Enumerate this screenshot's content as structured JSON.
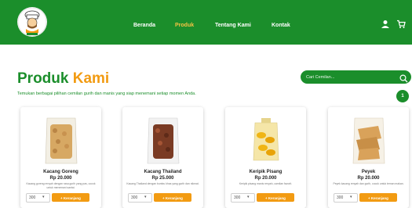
{
  "nav": {
    "links": [
      "Beranda",
      "Produk",
      "Tentang Kami",
      "Kontak"
    ],
    "active": "Produk",
    "icons": [
      "user-icon",
      "cart-icon"
    ]
  },
  "header": {
    "title_part1": "Produk",
    "title_part2": "Kami",
    "subtitle": "Temukan berbagai pilihan cemilan gurih dan manis yang siap menemani setiap momen Anda."
  },
  "search": {
    "placeholder": "Cari Cemilan..."
  },
  "cart": {
    "count": "1"
  },
  "products": [
    {
      "name": "Kacang Goreng",
      "price": "Rp 20.000",
      "desc": "Kacang goreng renyah dengan rasa gurih yang pas, cocok untuk menemani santai.",
      "qty": "300",
      "add_label": "+ Keranjang"
    },
    {
      "name": "Kacang Thailand",
      "price": "Rp 25.000",
      "desc": "Kacang Thailand dengan bumbu khas yang gurih dan nikmat.",
      "qty": "300",
      "add_label": "+ Keranjang"
    },
    {
      "name": "Keripik Pisang",
      "price": "Rp 20.000",
      "desc": "Keripik pisang manis renyah, camilan favorit.",
      "qty": "300",
      "add_label": "+ Keranjang"
    },
    {
      "name": "Peyek",
      "price": "Rp 20.000",
      "desc": "Peyek kacang renyah dan gurih, cocok untuk teman makan.",
      "qty": "300",
      "add_label": "+ Keranjang"
    }
  ]
}
